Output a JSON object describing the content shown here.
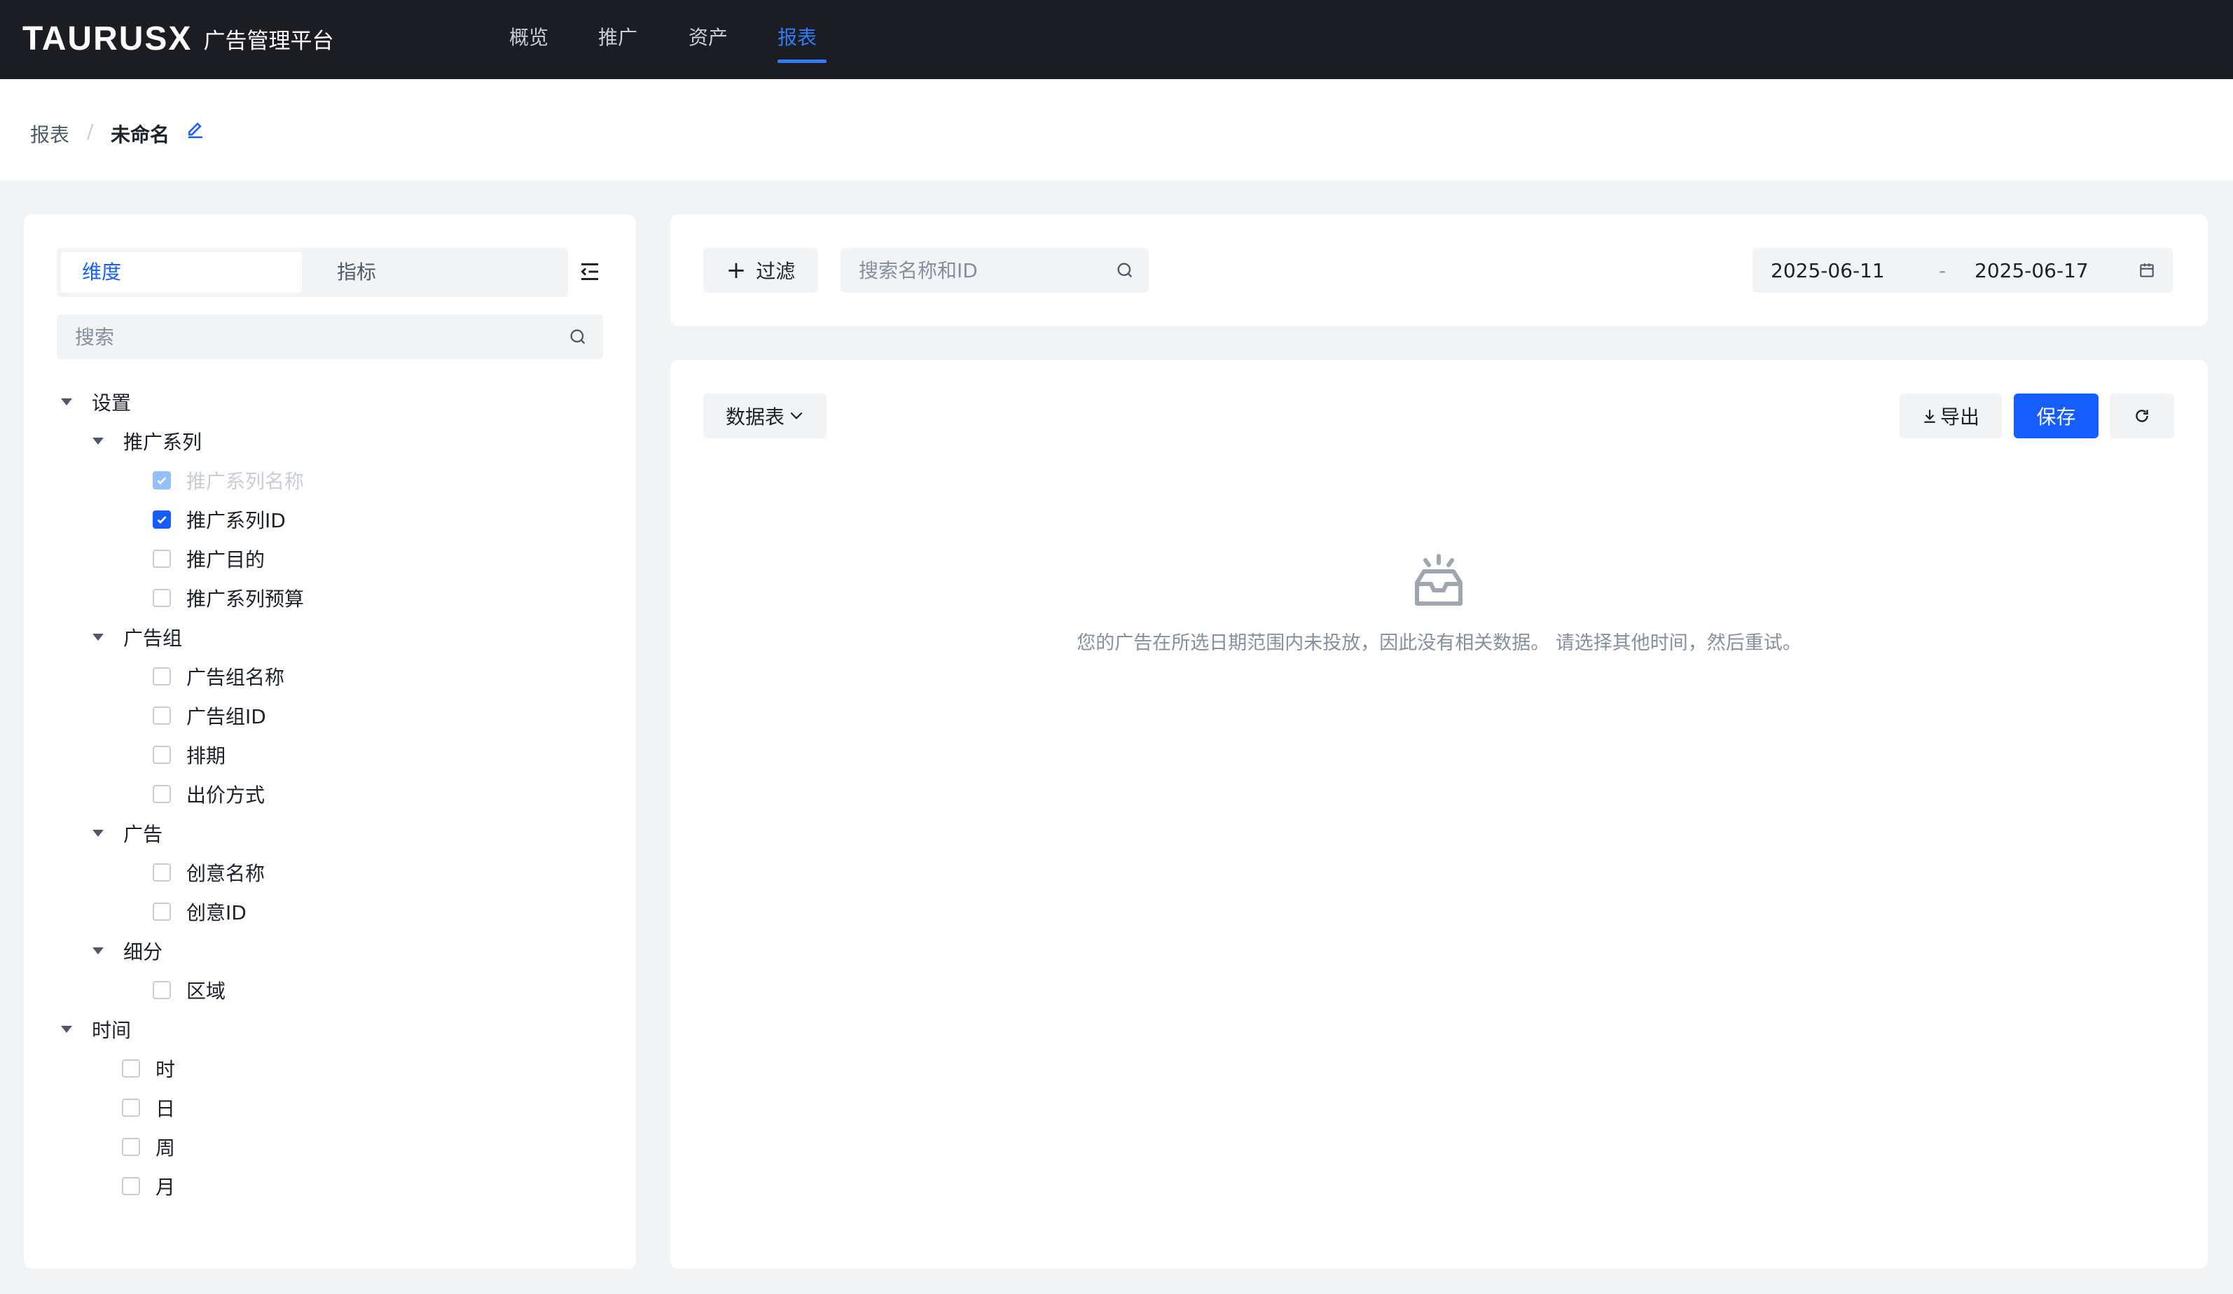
{
  "app": {
    "brand": "TAURUSX",
    "subtitle": "广告管理平台"
  },
  "nav": {
    "items": [
      "概览",
      "推广",
      "资产",
      "报表"
    ],
    "active": 3
  },
  "breadcrumb": {
    "root": "报表",
    "separator": "/",
    "current": "未命名"
  },
  "left_panel": {
    "tabs": [
      {
        "label": "维度",
        "active": true
      },
      {
        "label": "指标",
        "active": false
      }
    ],
    "search_placeholder": "搜索",
    "tree": {
      "settings": {
        "label": "设置",
        "campaign": {
          "label": "推广系列",
          "items": [
            {
              "label": "推广系列名称",
              "state": "checked-disabled"
            },
            {
              "label": "推广系列ID",
              "state": "checked"
            },
            {
              "label": "推广目的",
              "state": "unchecked"
            },
            {
              "label": "推广系列预算",
              "state": "unchecked"
            }
          ]
        },
        "ad_group": {
          "label": "广告组",
          "items": [
            {
              "label": "广告组名称",
              "state": "unchecked"
            },
            {
              "label": "广告组ID",
              "state": "unchecked"
            },
            {
              "label": "排期",
              "state": "unchecked"
            },
            {
              "label": "出价方式",
              "state": "unchecked"
            }
          ]
        },
        "ad": {
          "label": "广告",
          "items": [
            {
              "label": "创意名称",
              "state": "unchecked"
            },
            {
              "label": "创意ID",
              "state": "unchecked"
            }
          ]
        },
        "segment": {
          "label": "细分",
          "items": [
            {
              "label": "区域",
              "state": "unchecked"
            }
          ]
        }
      },
      "time": {
        "label": "时间",
        "items": [
          {
            "label": "时",
            "state": "unchecked"
          },
          {
            "label": "日",
            "state": "unchecked"
          },
          {
            "label": "周",
            "state": "unchecked"
          },
          {
            "label": "月",
            "state": "unchecked"
          }
        ]
      }
    }
  },
  "filter_bar": {
    "filter_label": "过滤",
    "search_placeholder": "搜索名称和ID",
    "date_start": "2025-06-11",
    "date_separator": "-",
    "date_end": "2025-06-17"
  },
  "content": {
    "view_label": "数据表",
    "export_label": "导出",
    "save_label": "保存",
    "empty_message": "您的广告在所选日期范围内未投放，因此没有相关数据。 请选择其他时间，然后重试。"
  },
  "colors": {
    "accent": "#165dff",
    "topbar": "#1c1d22",
    "page_bg": "#f2f3f5"
  },
  "icons": [
    "edit-icon",
    "collapse-list-icon",
    "search-icon",
    "plus-icon",
    "calendar-icon",
    "chevron-down-icon",
    "download-icon",
    "refresh-icon",
    "empty-inbox-icon",
    "check-icon",
    "caret-down-icon"
  ]
}
